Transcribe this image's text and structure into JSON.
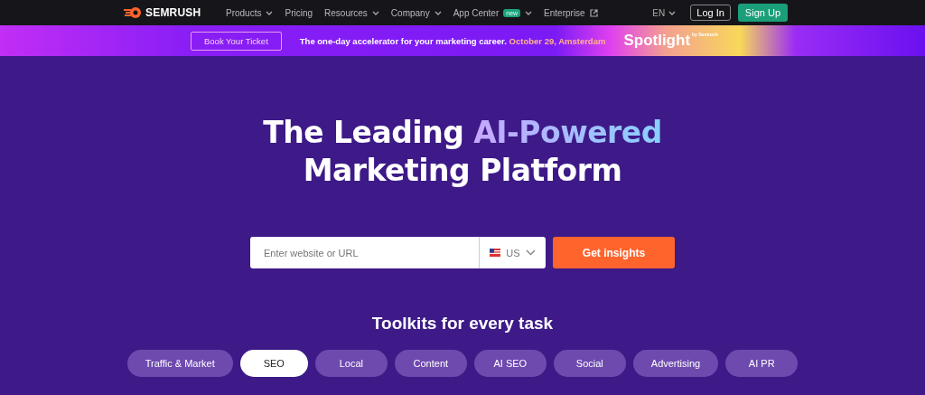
{
  "nav": {
    "logo": "SEMRUSH",
    "items": [
      {
        "label": "Products",
        "kind": "dropdown"
      },
      {
        "label": "Pricing",
        "kind": "link"
      },
      {
        "label": "Resources",
        "kind": "dropdown"
      },
      {
        "label": "Company",
        "kind": "dropdown"
      },
      {
        "label": "App Center",
        "kind": "dropdown",
        "badge": "new"
      },
      {
        "label": "Enterprise",
        "kind": "external"
      }
    ],
    "language": "EN",
    "login": "Log In",
    "signup": "Sign Up"
  },
  "banner": {
    "button": "Book Your Ticket",
    "message": "The one-day accelerator for your marketing career.",
    "highlight": "October 29, Amsterdam",
    "brand": "Spotlight",
    "brand_by": "by Semrush"
  },
  "hero": {
    "headline_lead": "The Leading",
    "headline_highlight": "AI-Powered",
    "headline_rest": "Marketing Platform",
    "search": {
      "placeholder": "Enter website or URL",
      "country": "US",
      "button": "Get insights"
    }
  },
  "toolkits": {
    "title": "Toolkits for every task",
    "tabs": [
      {
        "label": "Traffic & Market",
        "selected": false
      },
      {
        "label": "SEO",
        "selected": true
      },
      {
        "label": "Local",
        "selected": false
      },
      {
        "label": "Content",
        "selected": false
      },
      {
        "label": "AI SEO",
        "selected": false
      },
      {
        "label": "Social",
        "selected": false
      },
      {
        "label": "Advertising",
        "selected": false
      },
      {
        "label": "AI PR",
        "selected": false
      }
    ]
  }
}
